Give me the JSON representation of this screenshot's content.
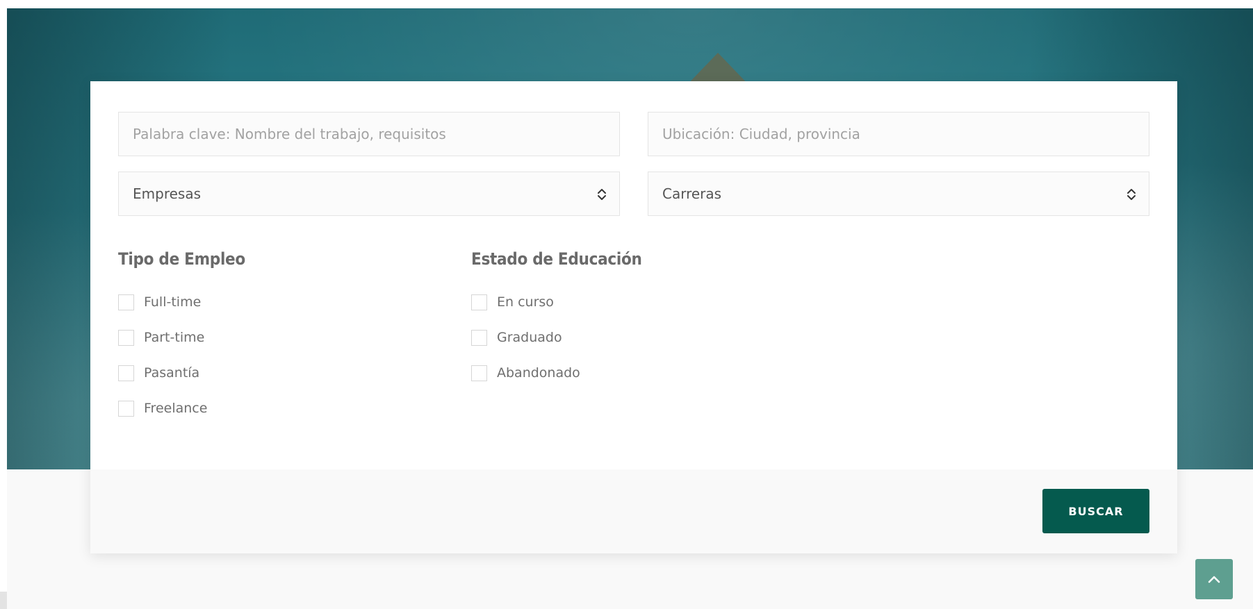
{
  "search": {
    "keyword": {
      "value": "",
      "placeholder": "Palabra clave: Nombre del trabajo, requisitos"
    },
    "location": {
      "value": "",
      "placeholder": "Ubicación: Ciudad, provincia"
    },
    "companies_select": {
      "selected": "Empresas",
      "icon": "chevron-up-down-icon"
    },
    "careers_select": {
      "selected": "Carreras",
      "icon": "chevron-up-down-icon"
    }
  },
  "filters": {
    "employment_type": {
      "title": "Tipo de Empleo",
      "options": [
        "Full-time",
        "Part-time",
        "Pasantía",
        "Freelance"
      ]
    },
    "education_status": {
      "title": "Estado de Educación",
      "options": [
        "En curso",
        "Graduado",
        "Abandonado"
      ]
    }
  },
  "actions": {
    "search_label": "BUSCAR",
    "back_to_top_icon": "chevron-up-icon"
  },
  "colors": {
    "primary": "#055a4e",
    "back_to_top": "#5e9f90",
    "hero_teal": "#2b7f8b"
  }
}
